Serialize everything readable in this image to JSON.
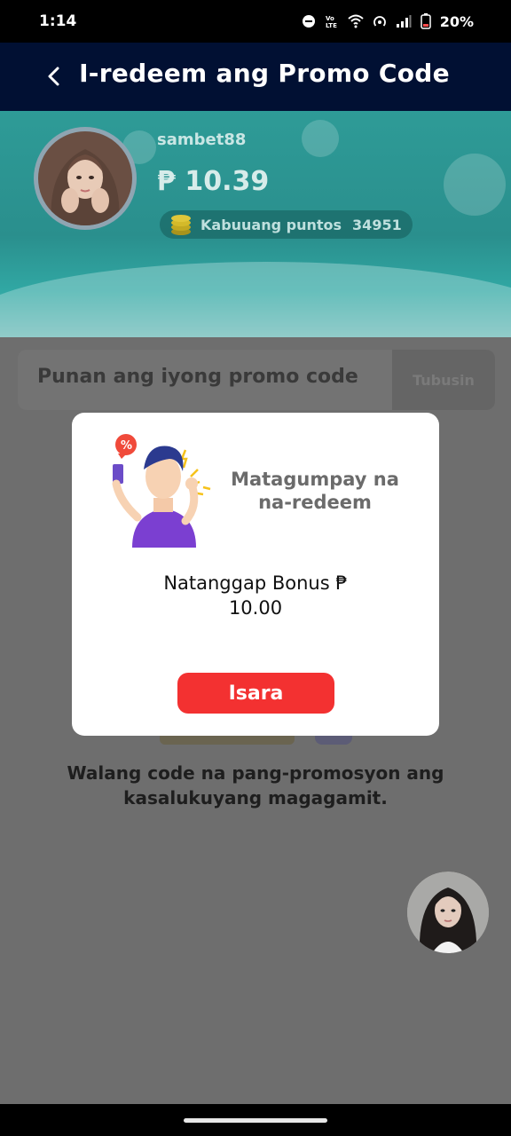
{
  "status_bar": {
    "time": "1:14",
    "battery_percent": "20%",
    "icons": [
      "do-not-disturb-icon",
      "volte-icon",
      "wifi-icon",
      "hotspot-icon",
      "signal-icon",
      "battery-icon"
    ]
  },
  "header": {
    "back_icon": "chevron-left-icon",
    "title": "I-redeem ang Promo Code"
  },
  "profile": {
    "username": "sambet88",
    "balance": "₱ 10.39",
    "points_label": "Kabuuang puntos",
    "points_value": "34951",
    "coin_icon": "coin-stack-icon"
  },
  "promo": {
    "placeholder": "Punan ang iyong promo code",
    "redeem_label": "Tubusin"
  },
  "empty_message": "Walang code na pang-promosyon ang kasalukuyang magagamit.",
  "modal": {
    "title": "Matagumpay na na-redeem",
    "bonus_text": "Natanggap Bonus ₱",
    "bonus_amount": "10.00",
    "close_label": "Isara"
  },
  "colors": {
    "header_bg": "#011033",
    "close_button": "#f33131",
    "overlay": "#6e6e6e"
  }
}
